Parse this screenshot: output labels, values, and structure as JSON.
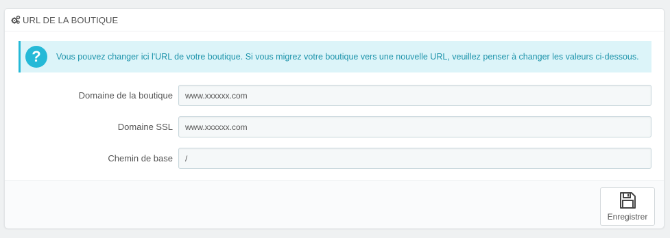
{
  "panel": {
    "heading": "URL de la boutique",
    "heading_icon": "gears-icon"
  },
  "alert": {
    "icon": "question-icon",
    "text": "Vous pouvez changer ici l'URL de votre boutique. Si vous migrez votre boutique vers une nouvelle URL, veuillez penser à changer les valeurs ci-dessous."
  },
  "fields": [
    {
      "label": "Domaine de la boutique",
      "value": "www.xxxxxx.com"
    },
    {
      "label": "Domaine SSL",
      "value": "www.xxxxxx.com"
    },
    {
      "label": "Chemin de base",
      "value": "/"
    }
  ],
  "footer": {
    "save_label": "Enregistrer",
    "save_icon": "floppy-disk-icon"
  }
}
